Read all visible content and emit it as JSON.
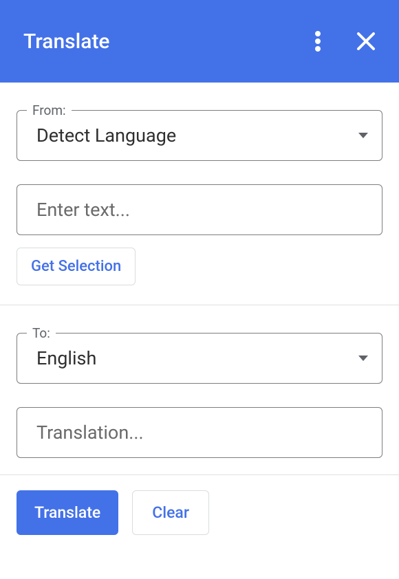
{
  "header": {
    "title": "Translate"
  },
  "from": {
    "label": "From:",
    "value": "Detect Language"
  },
  "input": {
    "placeholder": "Enter text..."
  },
  "get_selection_label": "Get Selection",
  "to": {
    "label": "To:",
    "value": "English"
  },
  "output": {
    "placeholder": "Translation..."
  },
  "footer": {
    "translate_label": "Translate",
    "clear_label": "Clear"
  }
}
